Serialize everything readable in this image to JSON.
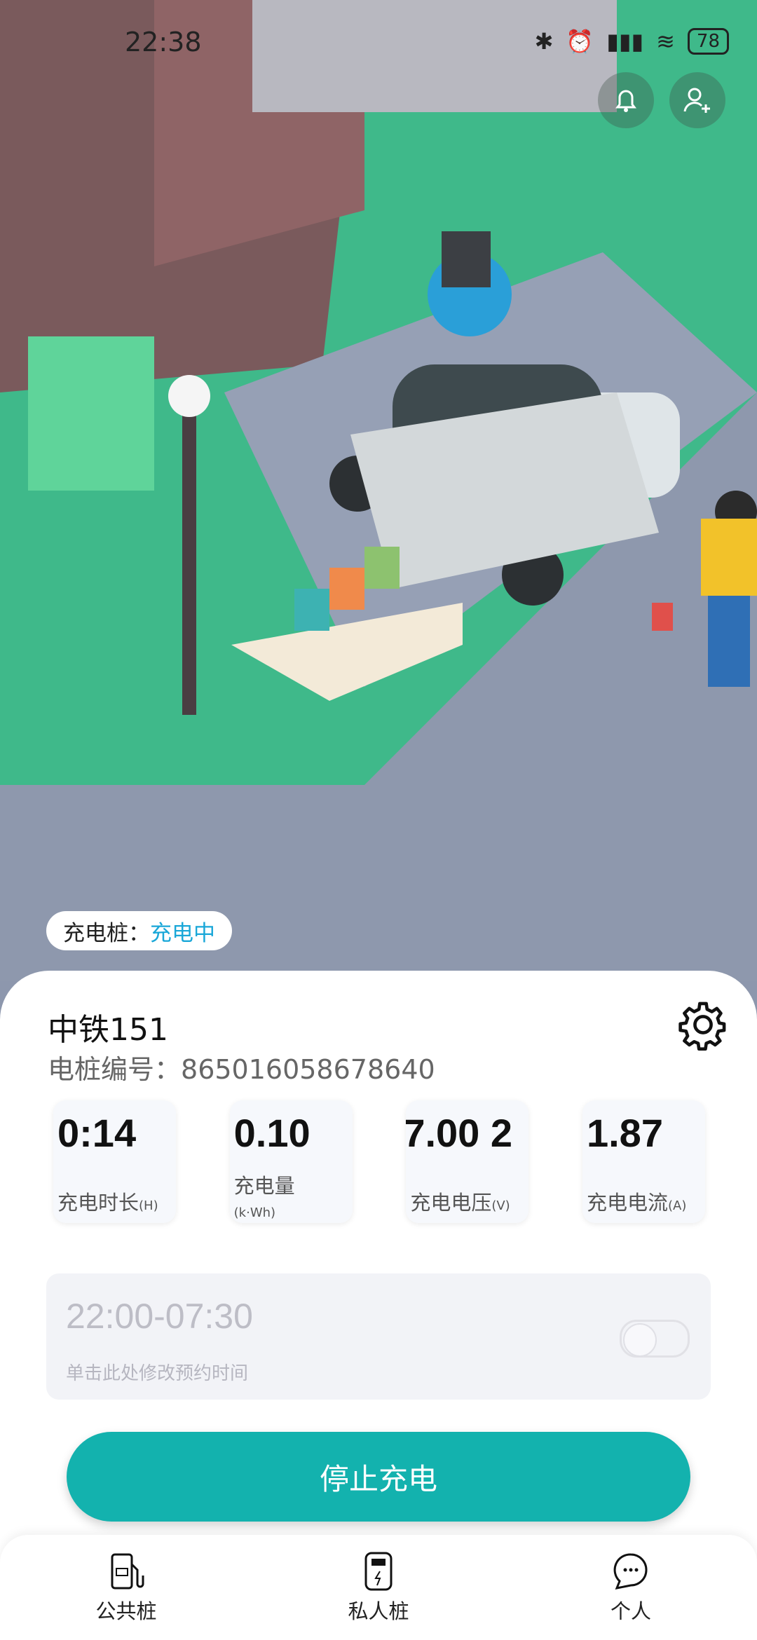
{
  "status_bar": {
    "time": "22:38",
    "battery": "78"
  },
  "charger_status": {
    "label": "充电桩：",
    "value": "充电中"
  },
  "station": {
    "name": "中铁151",
    "serial_label": "电桩编号：",
    "serial": "865016058678640"
  },
  "metrics": [
    {
      "value": "0:14",
      "label": "充电时长",
      "unit": "(H)"
    },
    {
      "value": "0.10",
      "label": "充电量",
      "unit": "(k·Wh)"
    },
    {
      "value": "7.00 2",
      "label": "充电电压",
      "unit": "(V)"
    },
    {
      "value": "1.87",
      "label": "充电电流",
      "unit": "(A)"
    }
  ],
  "schedule": {
    "time": "22:00-07:30",
    "hint": "单击此处修改预约时间",
    "enabled": false
  },
  "stop_button": "停止充电",
  "nav": [
    {
      "label": "公共桩",
      "icon": "public-charger-icon"
    },
    {
      "label": "私人桩",
      "icon": "private-charger-icon"
    },
    {
      "label": "个人",
      "icon": "chat-person-icon"
    }
  ]
}
